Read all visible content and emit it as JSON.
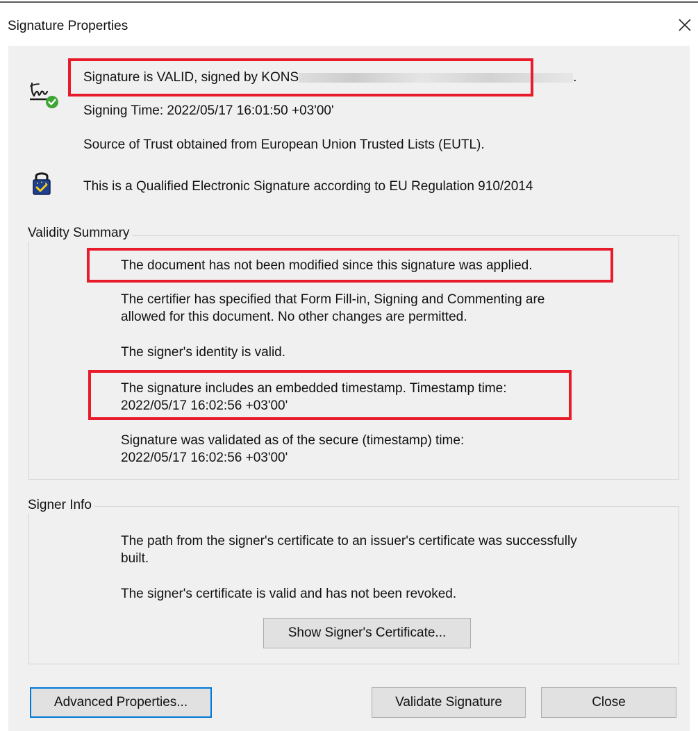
{
  "window": {
    "title": "Signature Properties"
  },
  "icons": {
    "close": "close-icon",
    "signature": "signature-valid-icon",
    "qualified": "qualified-signature-lock-icon"
  },
  "header": {
    "status_text": "Signature is VALID, signed by KONS",
    "status_text_end": ".",
    "signing_time": "Signing Time:  2022/05/17 16:01:50 +03'00'",
    "trust_source": "Source of Trust obtained from European Union Trusted Lists (EUTL).",
    "qualified_text": "This is a Qualified Electronic Signature according to EU Regulation 910/2014"
  },
  "validity_summary": {
    "label": "Validity Summary",
    "not_modified": "The document has not been modified since this signature was applied.",
    "certifier_line1": "The certifier has specified that Form Fill-in, Signing and Commenting are",
    "certifier_line2": "allowed for this document. No other changes are permitted.",
    "identity": "The signer's identity is valid.",
    "timestamp_line1": "The signature includes an embedded timestamp. Timestamp time:",
    "timestamp_line2": "2022/05/17 16:02:56 +03'00'",
    "validated_line1": "Signature was validated as of the secure (timestamp) time:",
    "validated_line2": "2022/05/17 16:02:56 +03'00'"
  },
  "signer_info": {
    "label": "Signer Info",
    "path_line1": "The path from the signer's certificate to an issuer's certificate was successfully",
    "path_line2": "built.",
    "cert_valid": "The signer's certificate is valid and has not been revoked.",
    "show_cert_button": "Show Signer's Certificate..."
  },
  "buttons": {
    "advanced": "Advanced Properties...",
    "validate": "Validate Signature",
    "close": "Close"
  },
  "colors": {
    "highlight_box": "#e81b2b",
    "default_button_border": "#0078d7",
    "valid_check": "#3fa534",
    "lock_body": "#1f3f8f"
  }
}
